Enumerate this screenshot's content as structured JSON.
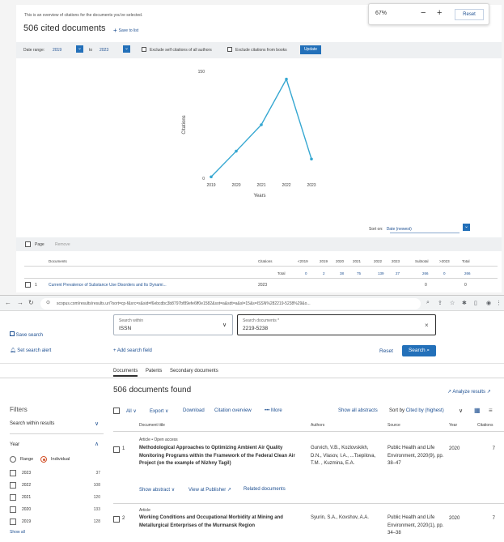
{
  "overview": {
    "subtitle": "This is an overview of citations for the documents you've selected.",
    "title": "506 cited documents",
    "save_to_list": "Save to list",
    "date_range_label": "Date range:",
    "date_from": "2019",
    "date_to_label": "to",
    "date_to": "2023",
    "exclude_self": "Exclude self citations of all authors",
    "exclude_books": "Exclude citations from books",
    "update_button": "Update",
    "sort_on_label": "Sort on:",
    "sort_on_value": "Date (newest)",
    "page_label": "Page",
    "remove_label": "Remove",
    "table_headers": [
      "Documents",
      "Citations",
      "<2019",
      "2019",
      "2020",
      "2021",
      "2022",
      "2023",
      "Subtotal",
      ">2023",
      "Total"
    ],
    "total_row": {
      "label": "Total",
      "values": [
        "0",
        "2",
        "38",
        "75",
        "139",
        "27",
        "266",
        "0",
        "266"
      ]
    },
    "first_document": {
      "title": "Current Prevalence of Substance Use Disorders and Its Dynami...",
      "year": "2023",
      "subtotal": "0",
      "total": "0"
    }
  },
  "zoom_popup": {
    "percent": "67%",
    "minus": "−",
    "plus": "+",
    "reset": "Reset"
  },
  "chart_data": {
    "type": "line",
    "x": [
      "2019",
      "2020",
      "2021",
      "2022",
      "2023"
    ],
    "series": [
      {
        "values": [
          2,
          38,
          75,
          139,
          27
        ]
      }
    ],
    "xlabel": "Years",
    "ylabel": "Citations",
    "yticks": [
      "0",
      "150"
    ],
    "ylim": [
      0,
      150
    ],
    "color": "#35a7d1"
  },
  "browser": {
    "url": "scopus.com/results/results.uri?sort=cp-f&src=s&sid=f6ebcdbc3b8797bf89efe6ff0e1582&sot=a&sdt=a&sl=15&s=ISSN%282219-5238%29&o..."
  },
  "sidebar": {
    "save_search": "Save search",
    "set_alert": "Set search alert",
    "filters": "Filters",
    "search_within": "Search within results",
    "year": "Year",
    "range": "Range",
    "individual": "Individual",
    "years": [
      {
        "label": "2023",
        "count": "37"
      },
      {
        "label": "2022",
        "count": "108"
      },
      {
        "label": "2021",
        "count": "120"
      },
      {
        "label": "2020",
        "count": "133"
      },
      {
        "label": "2019",
        "count": "128"
      }
    ],
    "show_all": "Show all"
  },
  "search": {
    "within_label": "Search within",
    "within_value": "ISSN",
    "docs_label": "Search documents *",
    "docs_value": "2219-5238",
    "add_field": "+ Add search field",
    "reset": "Reset",
    "search_button": "Search"
  },
  "tabs": [
    "Documents",
    "Patents",
    "Secondary documents"
  ],
  "results": {
    "heading": "506 documents found",
    "analyze": "Analyze results",
    "all": "All",
    "export": "Export",
    "download": "Download",
    "citation_overview": "Citation overview",
    "more": "More",
    "show_all_abstracts": "Show all abstracts",
    "sort_by_label": "Sort by",
    "sort_by_value": "Cited by (highest)",
    "columns": [
      "Document title",
      "Authors",
      "Source",
      "Year",
      "Citations"
    ],
    "rows": [
      {
        "num": "1",
        "type": "Article • Open access",
        "title": "Methodological Approaches to Optimizing Ambient Air Quality Monitoring Programs within the Framework of the Federal Clean Air Project (on the example of Nizhny Tagil)",
        "authors": "Gurvich, V.B., Kozlovskikh, D.N., Vlasov, I.A., ...Tsepilova, T.M. , Kuzmina, E.A.",
        "source": "Public Health and Life Environment, 2020(9), pp. 38–47",
        "year": "2020",
        "citations": "7",
        "show_abstract": "Show abstract",
        "view_publisher": "View at Publisher",
        "related": "Related documents"
      },
      {
        "num": "2",
        "type": "Article",
        "title": "Working Conditions and Occupational Morbidity at Mining and Metallurgical Enterprises of the Murmansk Region",
        "authors": "Syurin, S.A., Kovshov, A.A.",
        "source": "Public Health and Life Environment, 2020(1), pp. 34–38",
        "year": "2020",
        "citations": "7"
      }
    ]
  }
}
